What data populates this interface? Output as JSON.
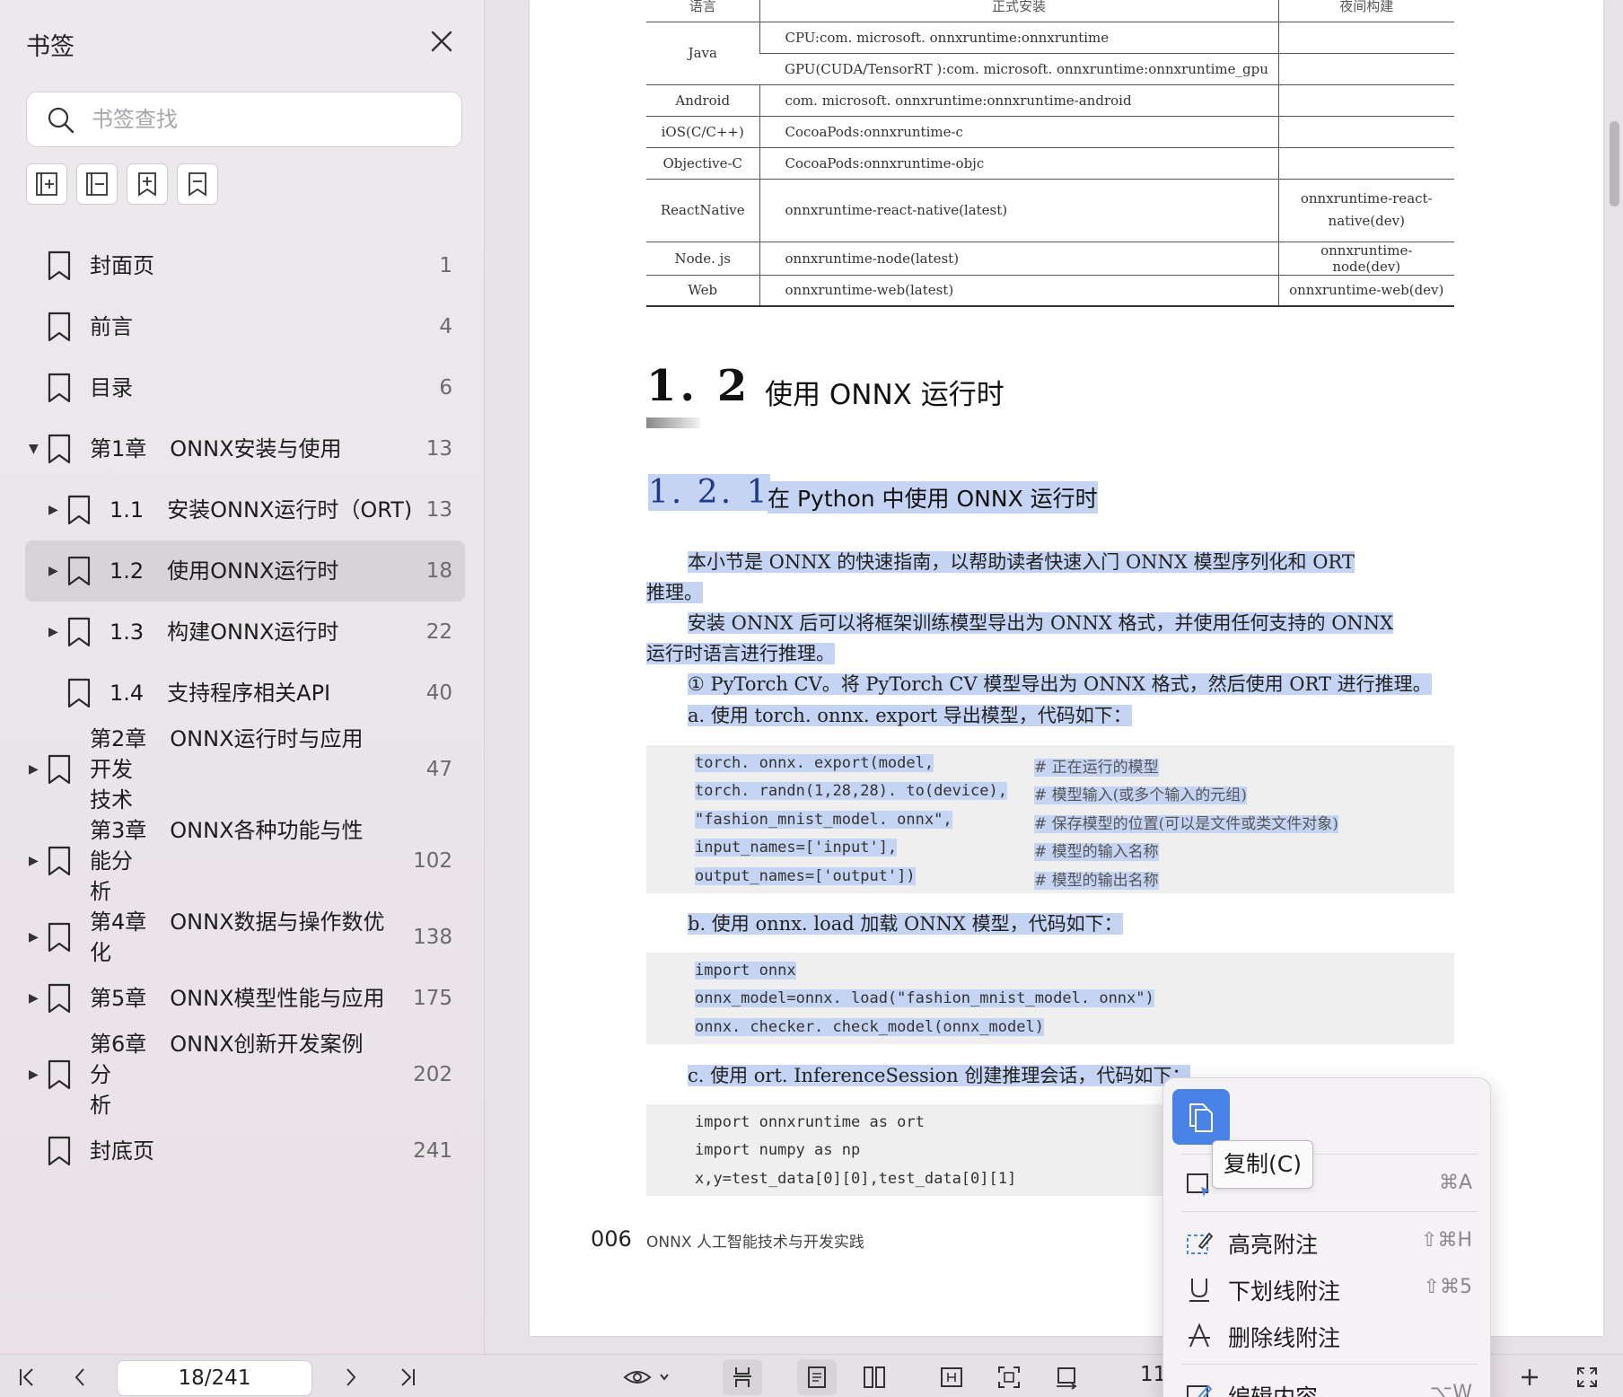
{
  "sidebar": {
    "title": "书签",
    "search_placeholder": "书签查找",
    "bookmarks": [
      {
        "num": "",
        "label": "封面页",
        "page": "1",
        "level": 0,
        "arrow": "none"
      },
      {
        "num": "",
        "label": "前言",
        "page": "4",
        "level": 0,
        "arrow": "none"
      },
      {
        "num": "",
        "label": "目录",
        "page": "6",
        "level": 0,
        "arrow": "none"
      },
      {
        "num": "第1章",
        "label": "ONNX安装与使用",
        "page": "13",
        "level": 0,
        "arrow": "expanded"
      },
      {
        "num": "1.1",
        "label": "安装ONNX运行时（ORT)",
        "page": "13",
        "level": 1,
        "arrow": "collapsed"
      },
      {
        "num": "1.2",
        "label": "使用ONNX运行时",
        "page": "18",
        "level": 1,
        "arrow": "collapsed",
        "selected": true
      },
      {
        "num": "1.3",
        "label": "构建ONNX运行时",
        "page": "22",
        "level": 1,
        "arrow": "collapsed"
      },
      {
        "num": "1.4",
        "label": "支持程序相关API",
        "page": "40",
        "level": 1,
        "arrow": "none"
      },
      {
        "num": "第2章",
        "label": "ONNX运行时与应用开发",
        "label2": "技术",
        "page": "47",
        "level": 0,
        "arrow": "collapsed"
      },
      {
        "num": "第3章",
        "label": "ONNX各种功能与性能分",
        "label2": "析",
        "page": "102",
        "level": 0,
        "arrow": "collapsed"
      },
      {
        "num": "第4章",
        "label": "ONNX数据与操作数优化",
        "page": "138",
        "level": 0,
        "arrow": "collapsed"
      },
      {
        "num": "第5章",
        "label": "ONNX模型性能与应用",
        "page": "175",
        "level": 0,
        "arrow": "collapsed"
      },
      {
        "num": "第6章",
        "label": "ONNX创新开发案例分",
        "label2": "析",
        "page": "202",
        "level": 0,
        "arrow": "collapsed"
      },
      {
        "num": "",
        "label": "封底页",
        "page": "241",
        "level": 0,
        "arrow": "none"
      }
    ]
  },
  "table": {
    "headers": [
      "语言",
      "正式安装",
      "夜间构建"
    ],
    "rows": [
      [
        "Java",
        "CPU:com. microsoft. onnxruntime:onnxruntime",
        ""
      ],
      [
        "",
        "GPU(CUDA/TensorRT ):com. microsoft. onnxruntime:onnxruntime_gpu",
        ""
      ],
      [
        "Android",
        "com. microsoft. onnxruntime:onnxruntime-android",
        ""
      ],
      [
        "iOS(C/C++)",
        "CocoaPods:onnxruntime-c",
        ""
      ],
      [
        "Objective-C",
        "CocoaPods:onnxruntime-objc",
        ""
      ],
      [
        "ReactNative",
        "onnxruntime-react-native(latest)",
        "onnxruntime-react-native(dev)"
      ],
      [
        "Node. js",
        "onnxruntime-node(latest)",
        "onnxruntime-node(dev)"
      ],
      [
        "Web",
        "onnxruntime-web(latest)",
        "onnxruntime-web(dev)"
      ]
    ]
  },
  "section": {
    "num": "1. 2",
    "title": "使用 ONNX 运行时"
  },
  "subsection": {
    "num": "1. 2. 1",
    "title": "在 Python 中使用 ONNX 运行时"
  },
  "paragraphs": {
    "p1a": "本小节是 ONNX 的快速指南，以帮助读者快速入门 ONNX 模型序列化和 ORT",
    "p1b": "推理。",
    "p2a": "安装 ONNX 后可以将框架训练模型导出为 ONNX 格式，并使用任何支持的 ONNX",
    "p2b": "运行时语言进行推理。",
    "p3": "① PyTorch CV。将 PyTorch CV 模型导出为 ONNX 格式，然后使用 ORT 进行推理。",
    "p4": "a. 使用 torch. onnx. export 导出模型，代码如下：",
    "p5": "b. 使用 onnx. load 加载 ONNX 模型，代码如下：",
    "p6": "c. 使用 ort. InferenceSession 创建推理会话，代码如下："
  },
  "code1": [
    {
      "code": "torch. onnx. export(model,",
      "comment": "# 正在运行的模型"
    },
    {
      "code": "torch. randn(1,28,28). to(device),",
      "comment": "# 模型输入(或多个输入的元组)"
    },
    {
      "code": "\"fashion_mnist_model. onnx\",",
      "comment": "# 保存模型的位置(可以是文件或类文件对象)"
    },
    {
      "code": "input_names=['input'],",
      "comment": "# 模型的输入名称"
    },
    {
      "code": "output_names=['output'])",
      "comment": "# 模型的输出名称"
    }
  ],
  "code2": [
    "import onnx",
    "onnx_model=onnx. load(\"fashion_mnist_model. onnx\")",
    "onnx. checker. check_model(onnx_model)"
  ],
  "code3": [
    "import onnxruntime as ort",
    "import numpy as np",
    "x,y=test_data[0][0],test_data[0][1]"
  ],
  "footer": {
    "page_num": "006",
    "book_title": "ONNX 人工智能技术与开发实践"
  },
  "toolbar": {
    "page_field": "18/241",
    "zoom": "11("
  },
  "context_menu": {
    "tooltip": "复制(C)",
    "items": [
      {
        "label": "",
        "shortcut": "⌘A"
      },
      {
        "label": "高亮附注",
        "shortcut": "⇧⌘H"
      },
      {
        "label": "下划线附注",
        "shortcut": "⇧⌘5"
      },
      {
        "label": "删除线附注",
        "shortcut": ""
      },
      {
        "label": "编辑内容",
        "shortcut": "⌥W"
      }
    ]
  },
  "colors": {
    "accent": "#4a83e8",
    "selection": "#c6d4f3",
    "selected_row": "#d8d3d9"
  }
}
